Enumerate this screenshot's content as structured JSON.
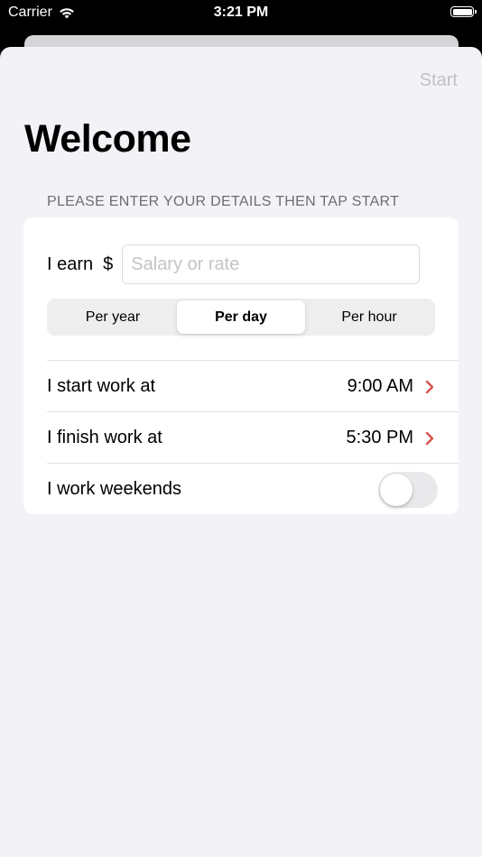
{
  "status_bar": {
    "carrier": "Carrier",
    "time": "3:21 PM",
    "battery_level": 1.0
  },
  "nav": {
    "start_label": "Start"
  },
  "page": {
    "title": "Welcome",
    "section_header": "PLEASE ENTER YOUR DETAILS THEN TAP START"
  },
  "earn": {
    "label": "I earn",
    "currency": "$",
    "placeholder": "Salary or rate",
    "value": ""
  },
  "period": {
    "options": [
      "Per year",
      "Per day",
      "Per hour"
    ],
    "selected": "Per day"
  },
  "rows": {
    "start": {
      "label": "I start work at",
      "value": "9:00 AM"
    },
    "finish": {
      "label": "I finish work at",
      "value": "5:30 PM"
    },
    "weekends": {
      "label": "I work weekends",
      "enabled": false
    }
  },
  "colors": {
    "accent": "#d9534f",
    "background": "#f2f2f7",
    "disabled_text": "#c2c2c6"
  },
  "icons": {
    "chevron": "chevron-right-icon",
    "wifi": "wifi-icon",
    "battery": "battery-icon"
  }
}
